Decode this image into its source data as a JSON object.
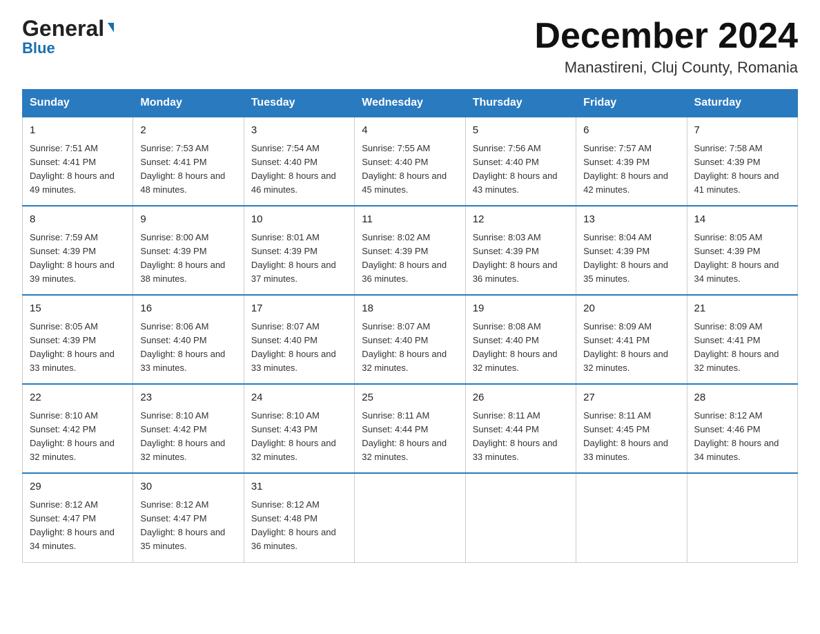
{
  "logo": {
    "general": "General",
    "blue": "Blue",
    "triangle": "▼"
  },
  "title": "December 2024",
  "subtitle": "Manastireni, Cluj County, Romania",
  "days_of_week": [
    "Sunday",
    "Monday",
    "Tuesday",
    "Wednesday",
    "Thursday",
    "Friday",
    "Saturday"
  ],
  "weeks": [
    [
      {
        "day": "1",
        "sunrise": "7:51 AM",
        "sunset": "4:41 PM",
        "daylight": "8 hours and 49 minutes."
      },
      {
        "day": "2",
        "sunrise": "7:53 AM",
        "sunset": "4:41 PM",
        "daylight": "8 hours and 48 minutes."
      },
      {
        "day": "3",
        "sunrise": "7:54 AM",
        "sunset": "4:40 PM",
        "daylight": "8 hours and 46 minutes."
      },
      {
        "day": "4",
        "sunrise": "7:55 AM",
        "sunset": "4:40 PM",
        "daylight": "8 hours and 45 minutes."
      },
      {
        "day": "5",
        "sunrise": "7:56 AM",
        "sunset": "4:40 PM",
        "daylight": "8 hours and 43 minutes."
      },
      {
        "day": "6",
        "sunrise": "7:57 AM",
        "sunset": "4:39 PM",
        "daylight": "8 hours and 42 minutes."
      },
      {
        "day": "7",
        "sunrise": "7:58 AM",
        "sunset": "4:39 PM",
        "daylight": "8 hours and 41 minutes."
      }
    ],
    [
      {
        "day": "8",
        "sunrise": "7:59 AM",
        "sunset": "4:39 PM",
        "daylight": "8 hours and 39 minutes."
      },
      {
        "day": "9",
        "sunrise": "8:00 AM",
        "sunset": "4:39 PM",
        "daylight": "8 hours and 38 minutes."
      },
      {
        "day": "10",
        "sunrise": "8:01 AM",
        "sunset": "4:39 PM",
        "daylight": "8 hours and 37 minutes."
      },
      {
        "day": "11",
        "sunrise": "8:02 AM",
        "sunset": "4:39 PM",
        "daylight": "8 hours and 36 minutes."
      },
      {
        "day": "12",
        "sunrise": "8:03 AM",
        "sunset": "4:39 PM",
        "daylight": "8 hours and 36 minutes."
      },
      {
        "day": "13",
        "sunrise": "8:04 AM",
        "sunset": "4:39 PM",
        "daylight": "8 hours and 35 minutes."
      },
      {
        "day": "14",
        "sunrise": "8:05 AM",
        "sunset": "4:39 PM",
        "daylight": "8 hours and 34 minutes."
      }
    ],
    [
      {
        "day": "15",
        "sunrise": "8:05 AM",
        "sunset": "4:39 PM",
        "daylight": "8 hours and 33 minutes."
      },
      {
        "day": "16",
        "sunrise": "8:06 AM",
        "sunset": "4:40 PM",
        "daylight": "8 hours and 33 minutes."
      },
      {
        "day": "17",
        "sunrise": "8:07 AM",
        "sunset": "4:40 PM",
        "daylight": "8 hours and 33 minutes."
      },
      {
        "day": "18",
        "sunrise": "8:07 AM",
        "sunset": "4:40 PM",
        "daylight": "8 hours and 32 minutes."
      },
      {
        "day": "19",
        "sunrise": "8:08 AM",
        "sunset": "4:40 PM",
        "daylight": "8 hours and 32 minutes."
      },
      {
        "day": "20",
        "sunrise": "8:09 AM",
        "sunset": "4:41 PM",
        "daylight": "8 hours and 32 minutes."
      },
      {
        "day": "21",
        "sunrise": "8:09 AM",
        "sunset": "4:41 PM",
        "daylight": "8 hours and 32 minutes."
      }
    ],
    [
      {
        "day": "22",
        "sunrise": "8:10 AM",
        "sunset": "4:42 PM",
        "daylight": "8 hours and 32 minutes."
      },
      {
        "day": "23",
        "sunrise": "8:10 AM",
        "sunset": "4:42 PM",
        "daylight": "8 hours and 32 minutes."
      },
      {
        "day": "24",
        "sunrise": "8:10 AM",
        "sunset": "4:43 PM",
        "daylight": "8 hours and 32 minutes."
      },
      {
        "day": "25",
        "sunrise": "8:11 AM",
        "sunset": "4:44 PM",
        "daylight": "8 hours and 32 minutes."
      },
      {
        "day": "26",
        "sunrise": "8:11 AM",
        "sunset": "4:44 PM",
        "daylight": "8 hours and 33 minutes."
      },
      {
        "day": "27",
        "sunrise": "8:11 AM",
        "sunset": "4:45 PM",
        "daylight": "8 hours and 33 minutes."
      },
      {
        "day": "28",
        "sunrise": "8:12 AM",
        "sunset": "4:46 PM",
        "daylight": "8 hours and 34 minutes."
      }
    ],
    [
      {
        "day": "29",
        "sunrise": "8:12 AM",
        "sunset": "4:47 PM",
        "daylight": "8 hours and 34 minutes."
      },
      {
        "day": "30",
        "sunrise": "8:12 AM",
        "sunset": "4:47 PM",
        "daylight": "8 hours and 35 minutes."
      },
      {
        "day": "31",
        "sunrise": "8:12 AM",
        "sunset": "4:48 PM",
        "daylight": "8 hours and 36 minutes."
      },
      null,
      null,
      null,
      null
    ]
  ],
  "labels": {
    "sunrise_prefix": "Sunrise: ",
    "sunset_prefix": "Sunset: ",
    "daylight_prefix": "Daylight: "
  }
}
